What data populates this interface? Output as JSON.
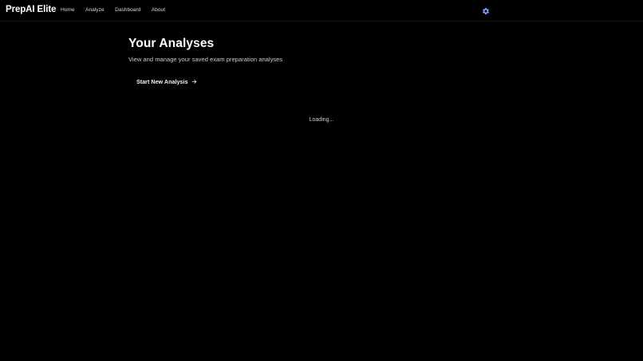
{
  "brand": {
    "name": "PrepAI Elite"
  },
  "nav": {
    "links": [
      {
        "label": "Home"
      },
      {
        "label": "Analyze"
      },
      {
        "label": "Dashboard"
      },
      {
        "label": "About"
      }
    ],
    "settings_icon": "gear-icon"
  },
  "main": {
    "title": "Your Analyses",
    "subtitle": "View and manage your saved exam preparation analyses",
    "cta_label": "Start New Analysis",
    "cta_icon": "arrow-right-icon",
    "loading_text": "Loading..."
  },
  "colors": {
    "background": "#000000",
    "text": "#ffffff",
    "muted_text": "#c9c9c9",
    "accent": "#7aa2ff"
  }
}
